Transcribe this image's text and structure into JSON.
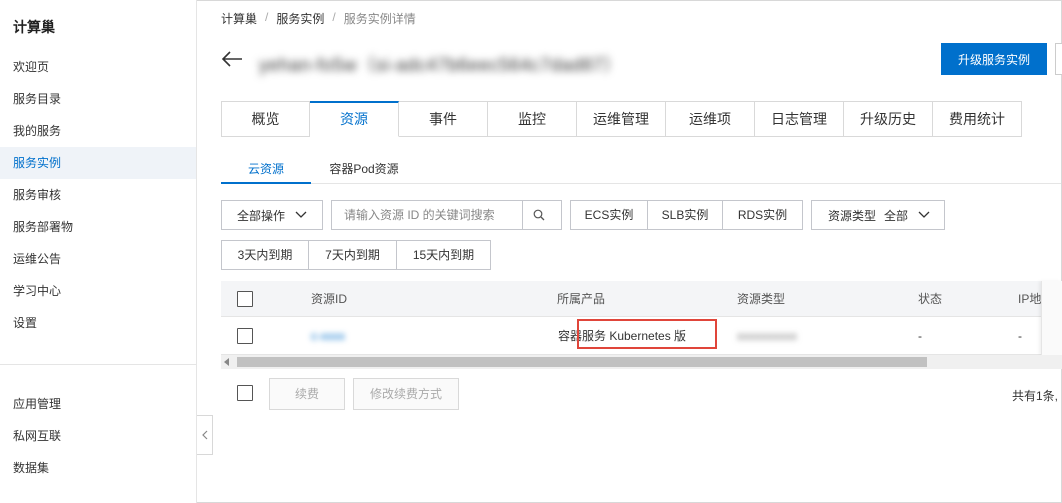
{
  "sidebar": {
    "title": "计算巢",
    "items": [
      {
        "label": "欢迎页",
        "active": false
      },
      {
        "label": "服务目录",
        "active": false
      },
      {
        "label": "我的服务",
        "active": false
      },
      {
        "label": "服务实例",
        "active": true
      },
      {
        "label": "服务审核",
        "active": false
      },
      {
        "label": "服务部署物",
        "active": false
      },
      {
        "label": "运维公告",
        "active": false
      },
      {
        "label": "学习中心",
        "active": false
      },
      {
        "label": "设置",
        "active": false
      }
    ],
    "bottom_items": [
      {
        "label": "应用管理"
      },
      {
        "label": "私网互联"
      },
      {
        "label": "数据集"
      }
    ]
  },
  "breadcrumb": {
    "items": [
      "计算巢",
      "服务实例",
      "服务实例详情"
    ]
  },
  "header": {
    "title": "yehan-fo5w（si-adc47b6eec564c7dad87）",
    "upgrade_label": "升级服务实例"
  },
  "tabs": [
    {
      "label": "概览",
      "active": false
    },
    {
      "label": "资源",
      "active": true
    },
    {
      "label": "事件",
      "active": false
    },
    {
      "label": "监控",
      "active": false
    },
    {
      "label": "运维管理",
      "active": false
    },
    {
      "label": "运维项",
      "active": false
    },
    {
      "label": "日志管理",
      "active": false
    },
    {
      "label": "升级历史",
      "active": false
    },
    {
      "label": "费用统计",
      "active": false
    }
  ],
  "subtabs": [
    {
      "label": "云资源",
      "active": true
    },
    {
      "label": "容器Pod资源",
      "active": false
    }
  ],
  "toolbar": {
    "all_actions_label": "全部操作",
    "search_placeholder": "请输入资源 ID 的关键词搜索",
    "filter_ecs": "ECS实例",
    "filter_slb": "SLB实例",
    "filter_rds": "RDS实例",
    "resource_type_label": "资源类型",
    "resource_type_value": "全部",
    "expire_3": "3天内到期",
    "expire_7": "7天内到期",
    "expire_15": "15天内到期"
  },
  "table": {
    "headers": [
      "资源ID",
      "所属产品",
      "资源类型",
      "状态",
      "IP地址"
    ],
    "rows": [
      {
        "resource_id": "c-xxxx",
        "product": "容器服务 Kubernetes 版",
        "resource_type": "xxxxxxxxxx",
        "status": "-",
        "ip": "-"
      }
    ]
  },
  "footer": {
    "renew_label": "续费",
    "change_renew_label": "修改续费方式",
    "pager_text": "共有1条,"
  },
  "colors": {
    "accent": "#0070cc",
    "highlight": "#e0453a",
    "sidebar_active_bg": "#eff3f8"
  }
}
